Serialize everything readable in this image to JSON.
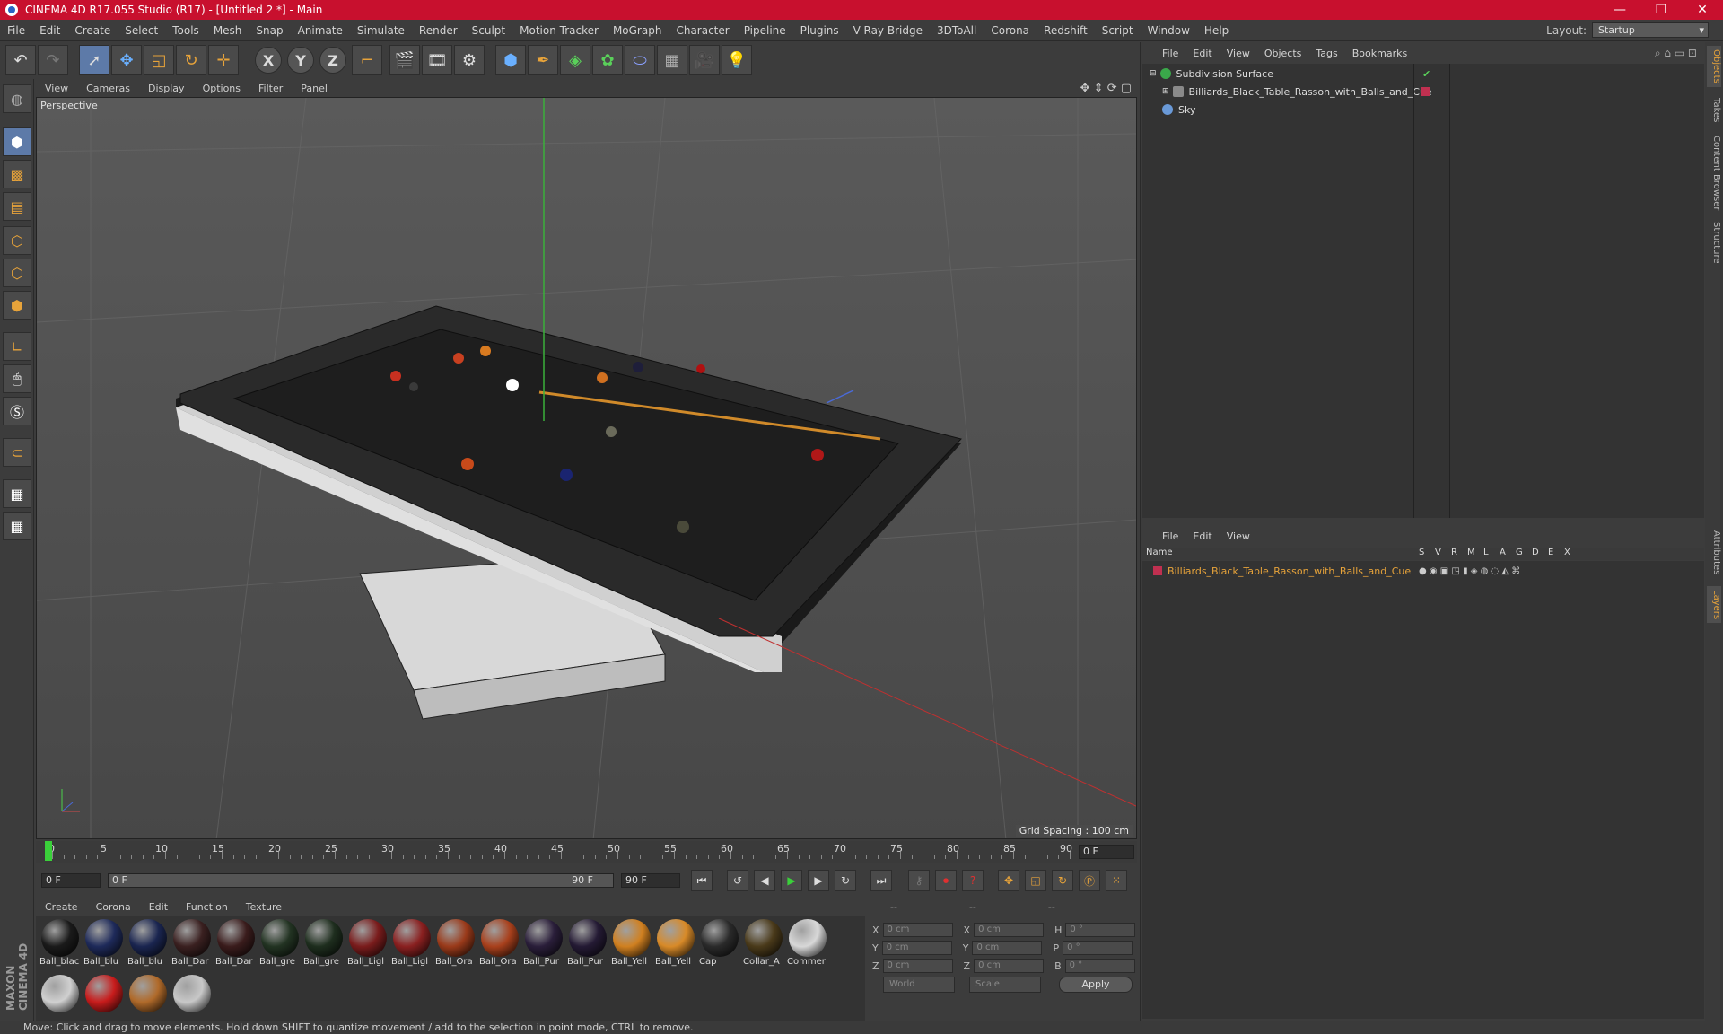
{
  "window": {
    "title": "CINEMA 4D R17.055 Studio (R17) - [Untitled 2 *] - Main",
    "min": "—",
    "restore": "❐",
    "close": "✕"
  },
  "menu": [
    "File",
    "Edit",
    "Create",
    "Select",
    "Tools",
    "Mesh",
    "Snap",
    "Animate",
    "Simulate",
    "Render",
    "Sculpt",
    "Motion Tracker",
    "MoGraph",
    "Character",
    "Pipeline",
    "Plugins",
    "V-Ray Bridge",
    "3DToAll",
    "Corona",
    "Redshift",
    "Script",
    "Window",
    "Help"
  ],
  "layout": {
    "label": "Layout:",
    "value": "Startup"
  },
  "toolbar": {
    "x": "X",
    "y": "Y",
    "z": "Z"
  },
  "viewport": {
    "menu": [
      "View",
      "Cameras",
      "Display",
      "Options",
      "Filter",
      "Panel"
    ],
    "label": "Perspective",
    "grid_spacing": "Grid Spacing : 100 cm"
  },
  "timeline": {
    "ticks": [
      "0",
      "5",
      "10",
      "15",
      "20",
      "25",
      "30",
      "35",
      "40",
      "45",
      "50",
      "55",
      "60",
      "65",
      "70",
      "75",
      "80",
      "85",
      "90"
    ],
    "current_frame": "0 F",
    "start": "0 F",
    "range_start": "0 F",
    "range_end": "90 F",
    "end": "90 F"
  },
  "materials": {
    "menu": [
      "Create",
      "Corona",
      "Edit",
      "Function",
      "Texture"
    ],
    "items": [
      {
        "label": "Ball_blac",
        "color": "#1a1a1a"
      },
      {
        "label": "Ball_blu",
        "color": "#1e2a5a"
      },
      {
        "label": "Ball_blu",
        "color": "#1a2550"
      },
      {
        "label": "Ball_Dar",
        "color": "#3a2020"
      },
      {
        "label": "Ball_Dar",
        "color": "#3a1c1c"
      },
      {
        "label": "Ball_gre",
        "color": "#223322"
      },
      {
        "label": "Ball_gre",
        "color": "#1e2e1e"
      },
      {
        "label": "Ball_Ligl",
        "color": "#7a1c1c"
      },
      {
        "label": "Ball_Ligl",
        "color": "#8a2020"
      },
      {
        "label": "Ball_Ora",
        "color": "#9a3a1a"
      },
      {
        "label": "Ball_Ora",
        "color": "#a8401c"
      },
      {
        "label": "Ball_Pur",
        "color": "#2a1e3a"
      },
      {
        "label": "Ball_Pur",
        "color": "#241a34"
      },
      {
        "label": "Ball_Yell",
        "color": "#d08020"
      },
      {
        "label": "Ball_Yell",
        "color": "#d88a28"
      },
      {
        "label": "Cap",
        "color": "#2a2a2a"
      },
      {
        "label": "Collar_A",
        "color": "#4a3a1a"
      },
      {
        "label": "Commer",
        "color": "#d8d8d8"
      }
    ],
    "row2": [
      {
        "label": "",
        "color": "#d0d0d0"
      },
      {
        "label": "",
        "color": "#c81c1c"
      },
      {
        "label": "",
        "color": "#b06a2a"
      },
      {
        "label": "",
        "color": "#c8c8c8"
      }
    ]
  },
  "coords": {
    "header": [
      "--",
      "--",
      "--"
    ],
    "rows": [
      {
        "a": "X",
        "av": "0 cm",
        "b": "X",
        "bv": "0 cm",
        "c": "H",
        "cv": "0 °"
      },
      {
        "a": "Y",
        "av": "0 cm",
        "b": "Y",
        "bv": "0 cm",
        "c": "P",
        "cv": "0 °"
      },
      {
        "a": "Z",
        "av": "0 cm",
        "b": "Z",
        "bv": "0 cm",
        "c": "B",
        "cv": "0 °"
      }
    ],
    "world": "World",
    "scale": "Scale",
    "apply": "Apply"
  },
  "objects": {
    "menu": [
      "File",
      "Edit",
      "View",
      "Objects",
      "Tags",
      "Bookmarks"
    ],
    "items": [
      {
        "name": "Subdivision Surface",
        "color": "#3aa84a"
      },
      {
        "name": "Billiards_Black_Table_Rasson_with_Balls_and_Cue",
        "color": "#8a8a8a"
      },
      {
        "name": "Sky",
        "color": "#6a9ad8"
      }
    ]
  },
  "layers": {
    "menu": [
      "File",
      "Edit",
      "View"
    ],
    "header": {
      "name": "Name",
      "cols": [
        "S",
        "V",
        "R",
        "M",
        "L",
        "A",
        "G",
        "D",
        "E",
        "X"
      ]
    },
    "items": [
      {
        "name": "Billiards_Black_Table_Rasson_with_Balls_and_Cue",
        "color": "#c03050"
      }
    ]
  },
  "side_tabs": [
    "Objects",
    "Takes",
    "Content Browser",
    "Structure",
    "Attributes",
    "Layers"
  ],
  "maxon": "MAXON CINEMA 4D",
  "status": "Move: Click and drag to move elements. Hold down SHIFT to quantize movement / add to the selection in point mode, CTRL to remove."
}
